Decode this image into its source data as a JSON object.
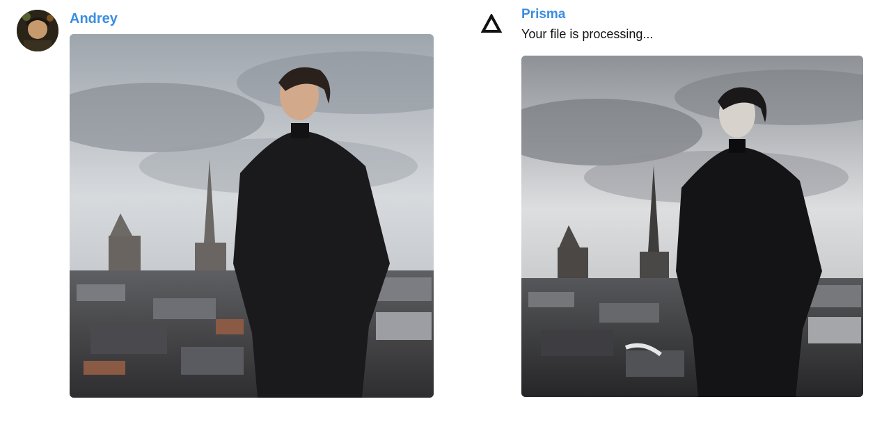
{
  "messages": [
    {
      "sender": "Andrey",
      "avatar_icon": "user-avatar-photo",
      "attachment": "photo-portrait-city-rooftops"
    },
    {
      "sender": "Prisma",
      "avatar_icon": "prisma-triangle-icon",
      "text": "Your file is processing...",
      "attachment": "photo-portrait-city-rooftops-stylized"
    }
  ],
  "colors": {
    "sender_name": "#3a8de0",
    "text": "#111111",
    "background": "#ffffff"
  }
}
